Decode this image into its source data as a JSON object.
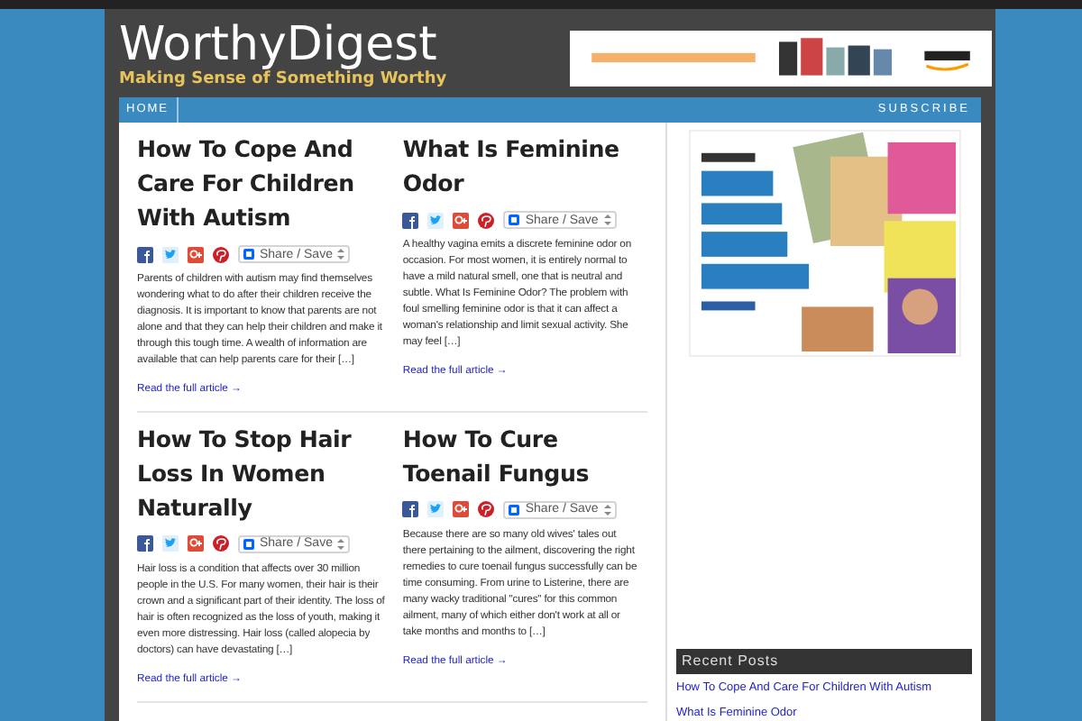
{
  "site": {
    "title": "WorthyDigest",
    "tagline": "Making Sense of Something Worthy"
  },
  "nav": {
    "items": [
      {
        "label": "HOME",
        "selected": true
      }
    ],
    "subscribe": "SUBSCRIBE"
  },
  "posts": [
    {
      "title": "How To Cope And Care For Children With Autism",
      "share": "Share / Save",
      "excerpt": "Parents of children with autism may find themselves wondering what to do after their children receive the diagnosis. It is important to know that parents are not alone and that they can help their children and make it through this tough time. A wealth of information are available that can help parents care for their […]",
      "link": "Read the full article →"
    },
    {
      "title": "What Is Feminine Odor",
      "share": "Share / Save",
      "excerpt": "A healthy vagina emits a discrete feminine odor on occasion. For most women, it is entirely normal to have a mild natural smell, one that is neutral and subtle. What Is Feminine Odor? The problem with foul smelling feminine odor is that it can affect a woman's relationship and limit sexual activity. She may feel […]",
      "link": "Read the full article →"
    },
    {
      "title": "How To Stop Hair Loss In Women Naturally",
      "share": "Share / Save",
      "excerpt": "Hair loss is a condition that affects over 30 million people in the U.S. For many women, their hair is their crown and a significant part of their identity. The loss of hair is often recognized as the loss of youth, making it even more distressing. Hair loss (called alopecia by doctors) can have devastating […]",
      "link": "Read the full article →"
    },
    {
      "title": "How To Cure Toenail Fungus",
      "share": "Share / Save",
      "excerpt": "Because there are so many old wives' tales out there pertaining to the ailment, discovering the right remedies to cure toenail fungus successfully can be time consuming. From urine to Listerine, there are many wacky traditional \"cures\" for this common ailment, many of which either don't work at all or take months and months to […]",
      "link": "Read the full article →"
    }
  ],
  "sidebar": {
    "recent_posts": {
      "title": "Recent Posts",
      "items": [
        "How To Cope And Care For Children With Autism",
        "What Is Feminine Odor"
      ]
    }
  }
}
